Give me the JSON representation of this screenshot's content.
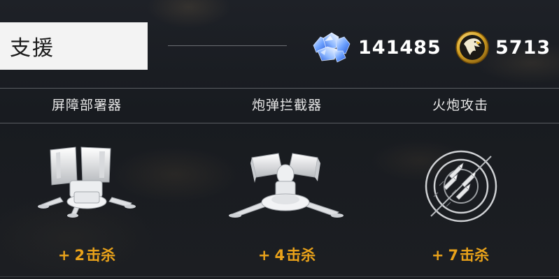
{
  "header": {
    "title": "支援"
  },
  "currencies": {
    "gems": {
      "icon": "crystal-icon",
      "value": "141485"
    },
    "coins": {
      "icon": "eagle-coin-icon",
      "value": "5713"
    }
  },
  "items": [
    {
      "name": "屏障部署器",
      "icon": "barrier-deployer-icon",
      "plus": "+",
      "kills": "2",
      "kill_unit": "击杀"
    },
    {
      "name": "炮弹拦截器",
      "icon": "shell-interceptor-icon",
      "plus": "+",
      "kills": "4",
      "kill_unit": "击杀"
    },
    {
      "name": "火炮攻击",
      "icon": "artillery-strike-icon",
      "plus": "+",
      "kills": "7",
      "kill_unit": "击杀"
    }
  ],
  "colors": {
    "kill_text": "#e9a21a",
    "title_bg": "#f3f3f3"
  }
}
